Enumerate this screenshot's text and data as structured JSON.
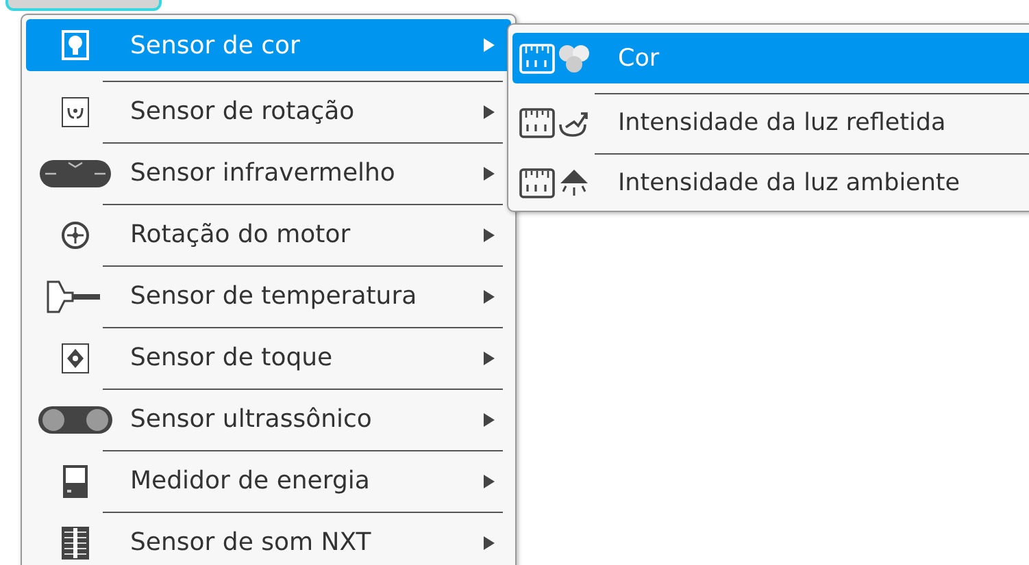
{
  "menu": {
    "items": [
      {
        "label": "Sensor de cor",
        "selected": true
      },
      {
        "label": "Sensor de rotação",
        "selected": false
      },
      {
        "label": "Sensor infravermelho",
        "selected": false
      },
      {
        "label": "Rotação do motor",
        "selected": false
      },
      {
        "label": "Sensor de temperatura",
        "selected": false
      },
      {
        "label": "Sensor de toque",
        "selected": false
      },
      {
        "label": "Sensor ultrassônico",
        "selected": false
      },
      {
        "label": "Medidor de energia",
        "selected": false
      },
      {
        "label": "Sensor de som NXT",
        "selected": false
      }
    ]
  },
  "submenu": {
    "items": [
      {
        "label": "Cor",
        "selected": true
      },
      {
        "label": "Intensidade da luz refletida",
        "selected": false
      },
      {
        "label": "Intensidade da luz ambiente",
        "selected": false
      }
    ]
  }
}
